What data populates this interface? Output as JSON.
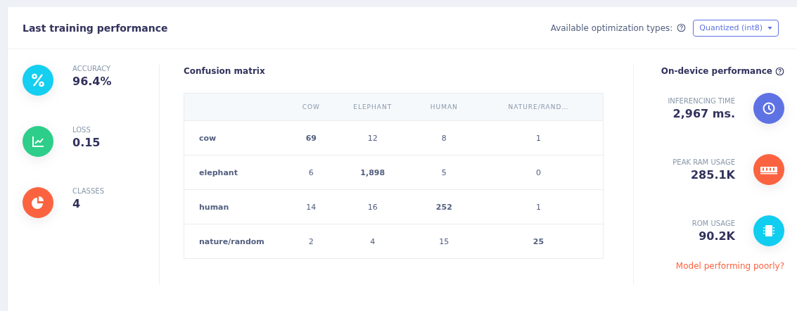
{
  "header": {
    "title": "Last training performance",
    "optimization_label": "Available optimization types:",
    "optimization_value": "Quantized (int8)"
  },
  "metrics": [
    {
      "kind": "percent",
      "label": "ACCURACY",
      "value": "96.4%",
      "color": "#14cff0"
    },
    {
      "kind": "chart",
      "label": "LOSS",
      "value": "0.15",
      "color": "#2dce89"
    },
    {
      "kind": "pie",
      "label": "CLASSES",
      "value": "4",
      "color": "#fb6340"
    }
  ],
  "confusion_matrix": {
    "title": "Confusion matrix",
    "columns": [
      "COW",
      "ELEPHANT",
      "HUMAN",
      "NATURE/RAND…"
    ],
    "rows": [
      {
        "label": "cow",
        "cells": [
          "69",
          "12",
          "8",
          "1"
        ]
      },
      {
        "label": "elephant",
        "cells": [
          "6",
          "1,898",
          "5",
          "0"
        ]
      },
      {
        "label": "human",
        "cells": [
          "14",
          "16",
          "252",
          "1"
        ]
      },
      {
        "label": "nature/random",
        "cells": [
          "2",
          "4",
          "15",
          "25"
        ]
      }
    ]
  },
  "on_device": {
    "title": "On-device performance",
    "items": [
      {
        "kind": "clock",
        "label": "INFERENCING TIME",
        "value": "2,967 ms.",
        "color": "#5e72e4"
      },
      {
        "kind": "ram",
        "label": "PEAK RAM USAGE",
        "value": "285.1K",
        "color": "#fb6340"
      },
      {
        "kind": "chip",
        "label": "ROM USAGE",
        "value": "90.2K",
        "color": "#11cdef"
      }
    ],
    "link": "Model performing poorly?"
  }
}
